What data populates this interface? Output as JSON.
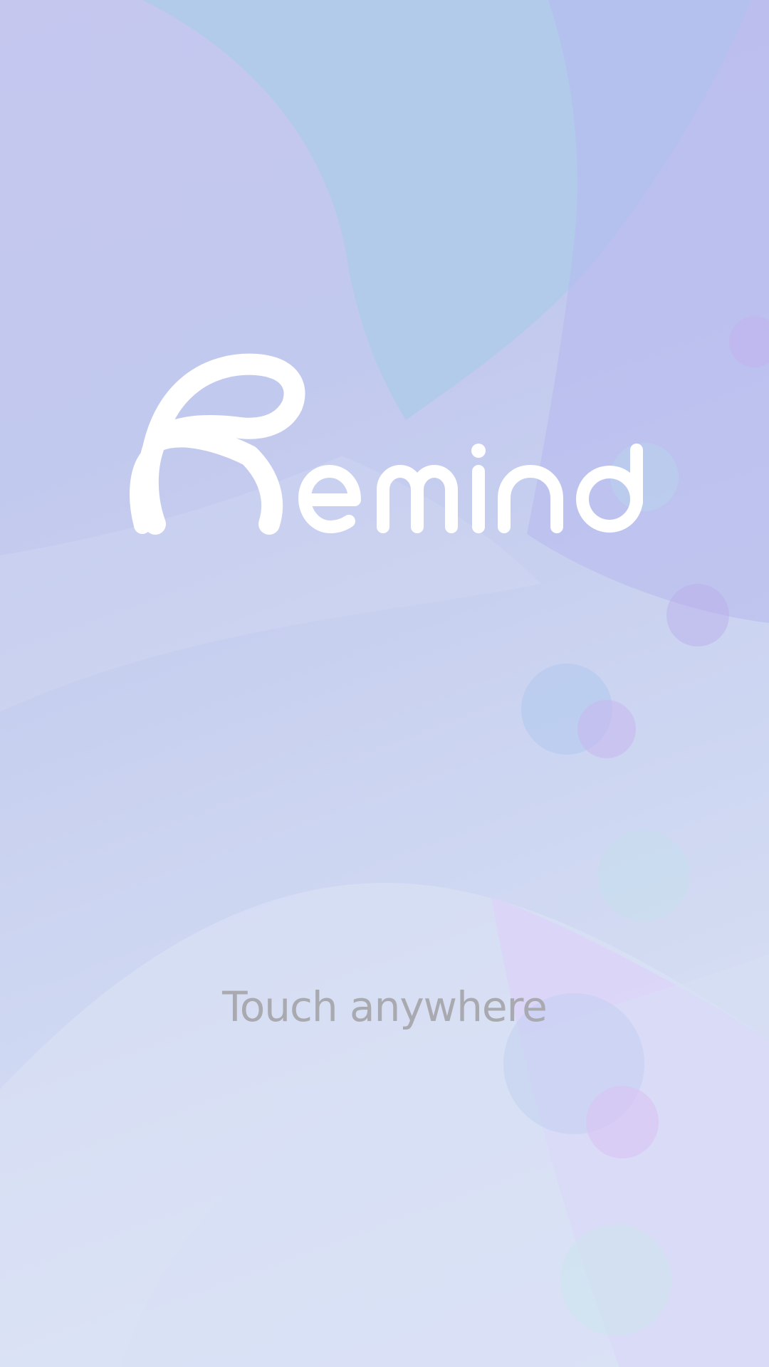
{
  "app": {
    "logo_text": "Remind"
  },
  "prompt": {
    "touch_label": "Touch anywhere"
  },
  "colors": {
    "logo": "#ffffff",
    "touch_label": "#a9a9b0",
    "background_lavender": "#c5c7ef",
    "background_sky": "#afcbe9",
    "background_light": "#dfe5f6"
  }
}
